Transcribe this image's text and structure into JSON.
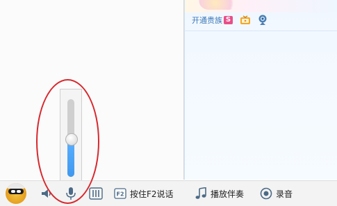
{
  "side_panel": {
    "vip_link": "开通贵族",
    "vip_badge": "S",
    "icons": [
      "tv-icon",
      "webcam-icon"
    ]
  },
  "volume": {
    "level": 0.48
  },
  "bottom_bar": {
    "icons": [
      "avatar",
      "speaker-icon",
      "microphone-icon",
      "equalizer-icon"
    ],
    "f2_key": "F2",
    "f2_talk_label": "按住F2说话",
    "play_accompaniment_label": "播放伴奏",
    "record_label": "录音"
  },
  "colors": {
    "accent_blue": "#4aa3f7",
    "highlight_red": "#d9262b",
    "link_blue": "#3b79b8"
  }
}
